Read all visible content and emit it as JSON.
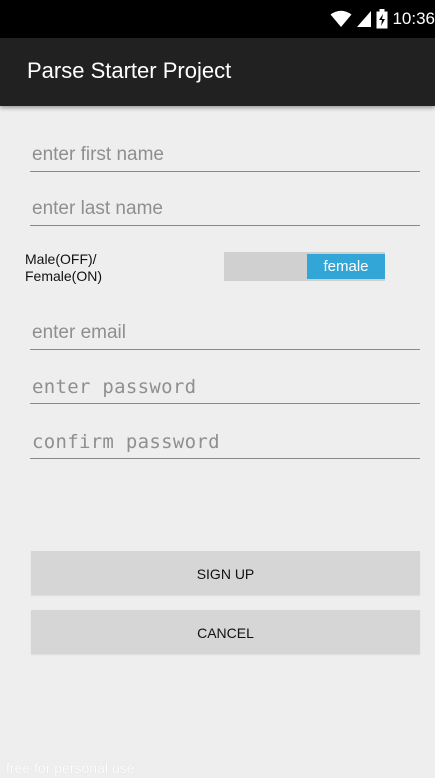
{
  "status_bar": {
    "time": "10:36",
    "icons": [
      "wifi-icon",
      "cell-signal-icon",
      "battery-icon"
    ]
  },
  "action_bar": {
    "title": "Parse Starter Project"
  },
  "form": {
    "first_name": {
      "value": "",
      "placeholder": "enter first name"
    },
    "last_name": {
      "value": "",
      "placeholder": "enter last name"
    },
    "gender": {
      "label_line1": "Male(OFF)/",
      "label_line2": "Female(ON)",
      "switch_text": "female",
      "checked": true
    },
    "email": {
      "value": "",
      "placeholder": "enter email"
    },
    "password": {
      "value": "",
      "placeholder": "enter password"
    },
    "confirm_password": {
      "value": "",
      "placeholder": "confirm password"
    }
  },
  "buttons": {
    "sign_up": "SIGN UP",
    "cancel": "CANCEL"
  },
  "watermark": "free for personal use",
  "colors": {
    "background": "#eeeeee",
    "status_bar": "#000000",
    "action_bar": "#212121",
    "switch_on": "#33a6d8",
    "button": "#d6d6d6"
  }
}
